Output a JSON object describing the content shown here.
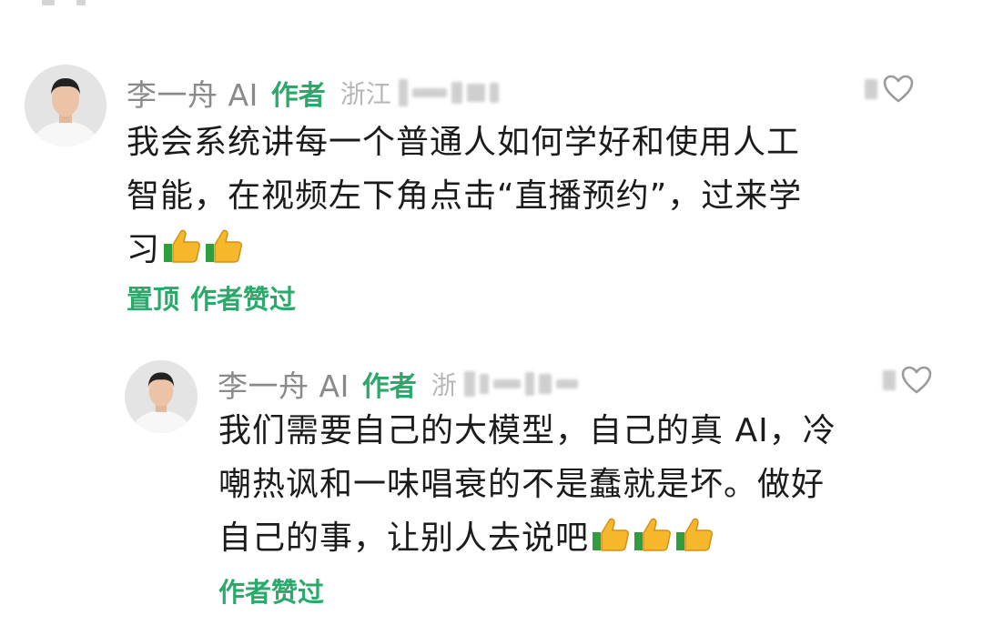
{
  "comments": [
    {
      "author": "李一舟 AI",
      "author_tag": "作者",
      "location": "浙江",
      "text_lines": [
        "我会系统讲每一个普通人如何学好和使用人工",
        "智能，在视频左下角点击“直播预约”，过来学",
        "习"
      ],
      "emoji": "thumbs-up",
      "emoji_count": 2,
      "badges": [
        "置顶",
        "作者赞过"
      ]
    },
    {
      "author": "李一舟 AI",
      "author_tag": "作者",
      "location": "浙",
      "text_lines": [
        "我们需要自己的大模型，自己的真 AI，冷",
        "嘲热讽和一味唱衰的不是蠢就是坏。做好",
        "自己的事，让别人去说吧"
      ],
      "emoji": "thumbs-up",
      "emoji_count": 3,
      "badges": [
        "作者赞过"
      ]
    }
  ],
  "colors": {
    "accent_green": "#2aa96b",
    "name_gray": "#8a8a8a",
    "body_text": "#1b1b1b",
    "emoji_yellow": "#f6b82a",
    "emoji_green": "#2e9e3e"
  },
  "icons": {
    "like": "heart-outline-icon",
    "emoji": "thumbs-up-icon"
  }
}
